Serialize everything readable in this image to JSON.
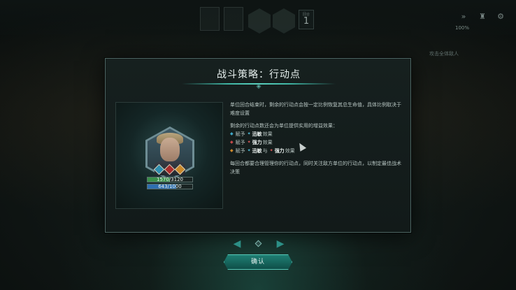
{
  "topbar": {
    "round_label": "回合",
    "round_number": "1",
    "speed_label": "100%",
    "buttons": [
      "fast-forward-icon",
      "helmet-icon",
      "gear-icon"
    ]
  },
  "background_hints": {
    "side": "攻击全体敌人"
  },
  "modal": {
    "title": "战斗策略：行动点",
    "paragraph1": "单位回合结束时，剩余的行动点会按一定比例恢复其总生命值，具体比例取决于难度设置",
    "paragraph2_intro": "剩余的行动点数还会为单位提供实用的增益效果：",
    "bullets": [
      {
        "color": "#3fa9c9",
        "prefix": "赋予",
        "kw1": "迅敏",
        "kw1_color": "#4fc1e0",
        "mid": "",
        "kw2": "",
        "kw2_color": "",
        "suffix": "效果"
      },
      {
        "color": "#c54a4a",
        "prefix": "赋予",
        "kw1": "强力",
        "kw1_color": "#e05b5b",
        "mid": "",
        "kw2": "",
        "kw2_color": "",
        "suffix": "效果"
      },
      {
        "color": "#d08a2c",
        "prefix": "赋予",
        "kw1": "迅敏",
        "kw1_color": "#4fc1e0",
        "mid": "与",
        "kw2": "强力",
        "kw2_color": "#e05b5b",
        "suffix": "效果"
      }
    ],
    "paragraph3": "每回合都要合理管理你的行动点，同时关注敌方单位的行动点，以制定最佳战术决策",
    "portrait": {
      "hp_text": "1570/3120",
      "hp_fraction": 0.503,
      "mp_text": "643/1000",
      "mp_fraction": 0.643,
      "hp_color": "#3b8f4b",
      "mp_color": "#2f6fb0",
      "gems": [
        "#2e8fb0",
        "#a82d2d",
        "#c8872a"
      ]
    }
  },
  "pager": {
    "prev_icon": "chevron-left-icon",
    "next_icon": "chevron-right-icon"
  },
  "confirm_label": "确认",
  "colors": {
    "accent": "#3fb4a3",
    "panel_border": "#4d6663"
  }
}
